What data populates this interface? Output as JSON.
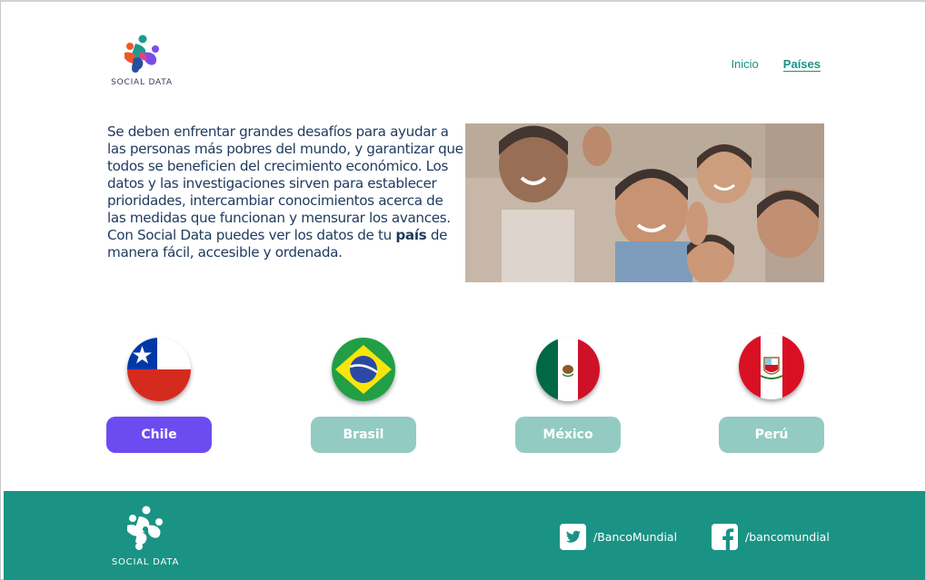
{
  "brand": {
    "name": "SOCIAL DATA"
  },
  "nav": [
    {
      "label": "Inicio",
      "active": false
    },
    {
      "label": "Países",
      "active": true
    }
  ],
  "intro": {
    "text_before": "Se deben enfrentar grandes desafíos para ayudar a las personas más pobres del mundo, y garantizar que todos se beneficien del crecimiento económico. Los datos y las investigaciones sirven para establecer prioridades, intercambiar conocimientos acerca de las medidas que funcionan y mensurar los avances. Con Social Data puedes ver los datos de tu ",
    "highlight": "país",
    "text_after": " de manera fácil, accesible y ordenada."
  },
  "countries": [
    {
      "label": "Chile",
      "selected": true,
      "color": "#6c4cf0"
    },
    {
      "label": "Brasil",
      "selected": false,
      "color": "#93cbc3"
    },
    {
      "label": "México",
      "selected": false,
      "color": "#93cbc3"
    },
    {
      "label": "Perú",
      "selected": false,
      "color": "#93cbc3"
    }
  ],
  "footer": {
    "brand": "SOCIAL DATA",
    "twitter": "/BancoMundial",
    "facebook": "/bancomundial",
    "bg_color": "#1a9384"
  }
}
